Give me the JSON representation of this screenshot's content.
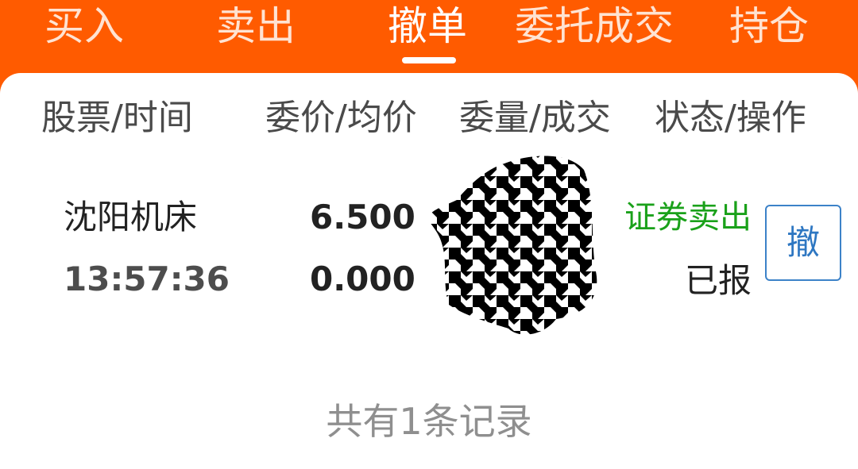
{
  "tabs": [
    {
      "label": "买入"
    },
    {
      "label": "卖出"
    },
    {
      "label": "撤单"
    },
    {
      "label": "委托成交"
    },
    {
      "label": "持仓"
    }
  ],
  "active_tab": "撤单",
  "columns": {
    "stock_time": "股票/时间",
    "price_avg": "委价/均价",
    "qty_deal": "委量/成交",
    "status_action": "状态/操作"
  },
  "order": {
    "stock_name": "沈阳机床",
    "time": "13:57:36",
    "order_price": "6.500",
    "avg_price": "0.000",
    "type": "证券卖出",
    "status": "已报",
    "action_label": "撤"
  },
  "footer": {
    "record_count": "共有1条记录"
  },
  "colors": {
    "accent": "#ff5b00",
    "sell_type": "#1aa11a",
    "cancel_button": "#2e77c2"
  }
}
